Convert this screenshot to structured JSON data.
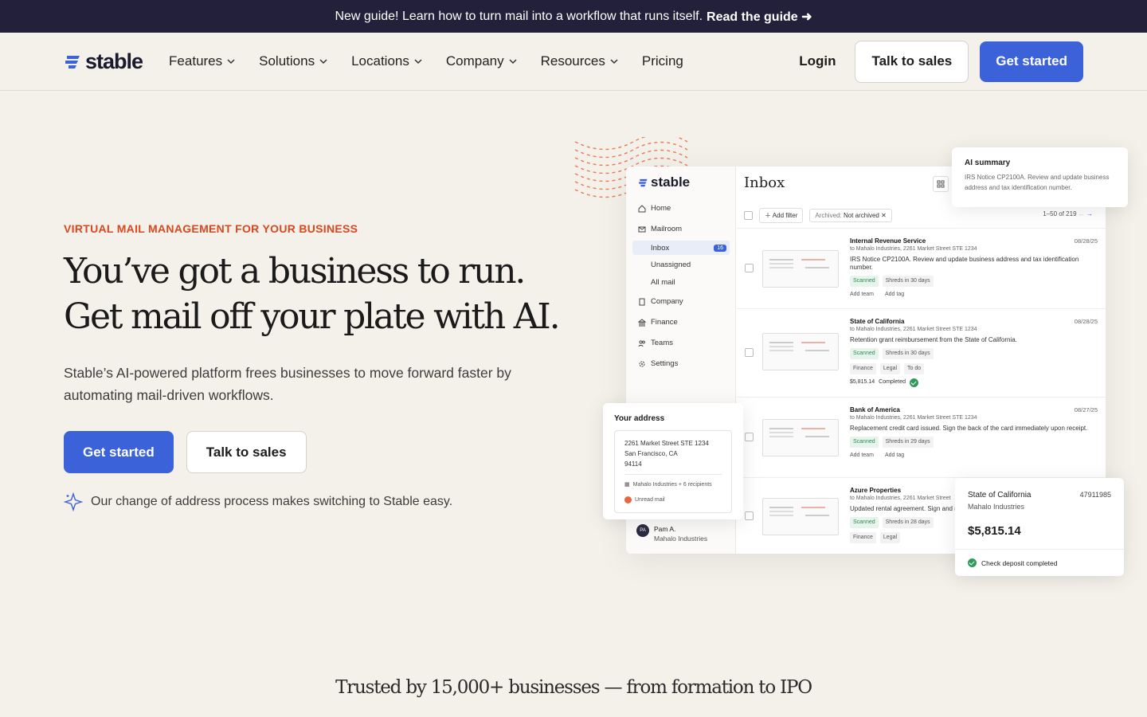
{
  "banner": {
    "text": "New guide! Learn how to turn mail into a workflow that runs itself.",
    "link": "Read the guide ➜"
  },
  "nav": {
    "brand": "stable",
    "items": [
      "Features",
      "Solutions",
      "Locations",
      "Company",
      "Resources",
      "Pricing"
    ],
    "login": "Login",
    "talk": "Talk to sales",
    "cta": "Get started"
  },
  "hero": {
    "eyebrow": "VIRTUAL MAIL MANAGEMENT FOR YOUR BUSINESS",
    "line1": "You’ve got a business to run.",
    "line2": "Get mail off your plate with AI.",
    "subtitle": "Stable’s AI-powered platform frees businesses to move forward faster by automating mail-driven workflows.",
    "cta_primary": "Get started",
    "cta_secondary": "Talk to sales",
    "note": "Our change of address process makes switching to Stable easy."
  },
  "app": {
    "brand": "stable",
    "sidebar": {
      "home": "Home",
      "mailroom": "Mailroom",
      "inbox": "Inbox",
      "inbox_count": "16",
      "unassigned": "Unassigned",
      "all_mail": "All mail",
      "company": "Company",
      "finance": "Finance",
      "teams": "Teams",
      "settings": "Settings"
    },
    "user": {
      "initials": "PA",
      "name": "Pam A.",
      "company": "Mahalo Industries"
    },
    "title": "Inbox",
    "add_filter": "Add filter",
    "archived_label": "Archived:",
    "archived_value": "Not archived",
    "pager": "1–50 of 219",
    "rows": [
      {
        "sender": "Internal Revenue Service",
        "to": "to Mahalo Industries, 2261 Market Street STE 1234",
        "date": "08/28/25",
        "summary": "IRS Notice CP2100A. Review and update business address and tax identification number.",
        "tag1": "Scanned",
        "tag2": "Shreds in 30 days",
        "a1": "Add team",
        "a2": "Add tag"
      },
      {
        "sender": "State of California",
        "to": "to Mahalo Industries, 2261 Market Street STE 1234",
        "date": "08/28/25",
        "summary": "Retention grant reimbursement from the State of California.",
        "tag1": "Scanned",
        "tag2": "Shreds in 30 days",
        "a1": "Finance",
        "a2": "Legal",
        "a3": "To do",
        "amount": "$5,815.14",
        "status": "Completed"
      },
      {
        "sender": "Bank of America",
        "to": "to Mahalo Industries, 2261 Market Street STE 1234",
        "date": "08/27/25",
        "summary": "Replacement credit card issued. Sign the back of the card immediately upon receipt.",
        "tag1": "Scanned",
        "tag2": "Shreds in 29 days",
        "a1": "Add team",
        "a2": "Add tag"
      },
      {
        "sender": "Azure Properties",
        "to": "to Mahalo Industries, 2261 Market Street",
        "summary": "Updated rental agreement. Sign and r",
        "tag1": "Scanned",
        "tag2": "Shreds in 28 days",
        "a1": "Finance",
        "a2": "Legal"
      }
    ]
  },
  "ai_summary": {
    "title": "AI summary",
    "text": "IRS Notice CP2100A. Review and update business address and tax identification number."
  },
  "address_card": {
    "title": "Your address",
    "line1": "2261 Market Street STE 1234",
    "line2": "San Francisco, CA",
    "line3": "94114",
    "recipients": "Mahalo Industries + 6 recipients",
    "unread": "Unread mail"
  },
  "check_card": {
    "payer": "State of California",
    "company": "Mahalo Industries",
    "number": "47911985",
    "amount": "$5,815.14",
    "status": "Check deposit completed"
  },
  "trusted": "Trusted by 15,000+ businesses — from formation to IPO"
}
